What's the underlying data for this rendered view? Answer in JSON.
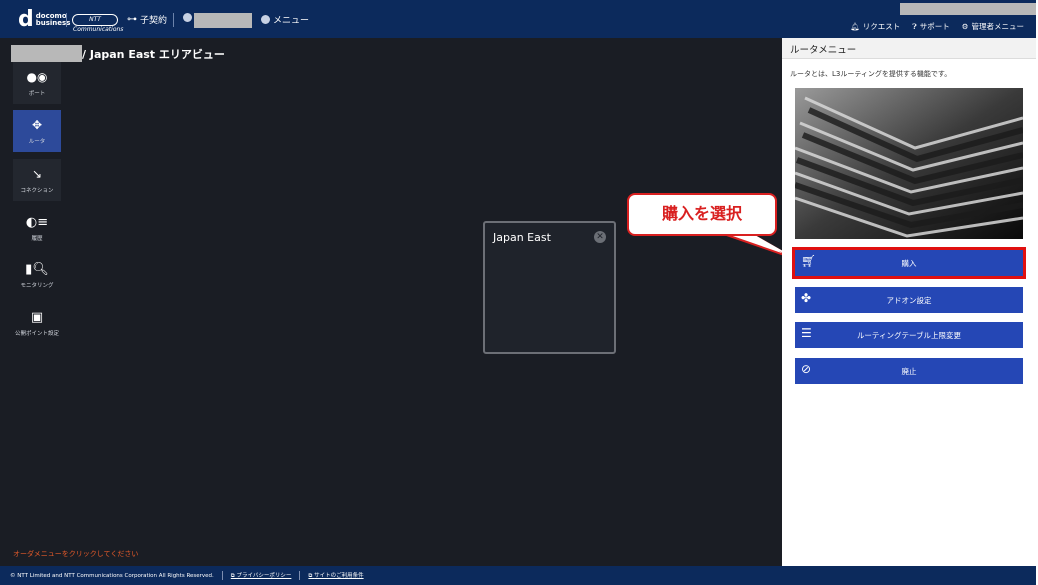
{
  "header": {
    "brand_docomo": "docomo",
    "brand_business": "business",
    "brand_ntt": "NTT Communications",
    "contract_label": "子契約",
    "menu_label": "メニュー",
    "right_items": [
      {
        "icon": "bell-icon",
        "label": "リクエスト"
      },
      {
        "icon": "help-icon",
        "label": "サポート"
      },
      {
        "icon": "gear-icon",
        "label": "管理者メニュー"
      }
    ]
  },
  "breadcrumb": "/ Japan East エリアビュー",
  "sidebar": {
    "items": [
      {
        "icon": "port-icon",
        "label": "ポート"
      },
      {
        "icon": "router-icon",
        "label": "ルータ"
      },
      {
        "icon": "connection-icon",
        "label": "コネクション"
      },
      {
        "icon": "history-icon",
        "label": "履歴"
      },
      {
        "icon": "monitoring-icon",
        "label": "モニタリング"
      },
      {
        "icon": "public-point-icon",
        "label": "公開ポイント設定"
      }
    ]
  },
  "region": {
    "name": "Japan East",
    "close": "✕"
  },
  "callout": "購入を選択",
  "order_tip": "オーダメニューをクリックしてください",
  "footer": {
    "copyright": "© NTT Limited and NTT Communications Corporation All Rights Reserved.",
    "privacy": "プライバシーポリシー",
    "terms": "サイトのご利用条件"
  },
  "panel": {
    "title": "ルータメニュー",
    "description": "ルータとは、L3ルーティングを提供する機能です。",
    "buttons": [
      {
        "icon": "cart-icon",
        "label": "購入"
      },
      {
        "icon": "puzzle-icon",
        "label": "アドオン設定"
      },
      {
        "icon": "sliders-icon",
        "label": "ルーティングテーブル上限変更"
      },
      {
        "icon": "cancel-icon",
        "label": "廃止"
      }
    ]
  },
  "colors": {
    "header": "#0c2a5c",
    "canvas": "#1a1d24",
    "button": "#2547b5",
    "highlight": "#e01010",
    "tip": "#e85b2a"
  }
}
